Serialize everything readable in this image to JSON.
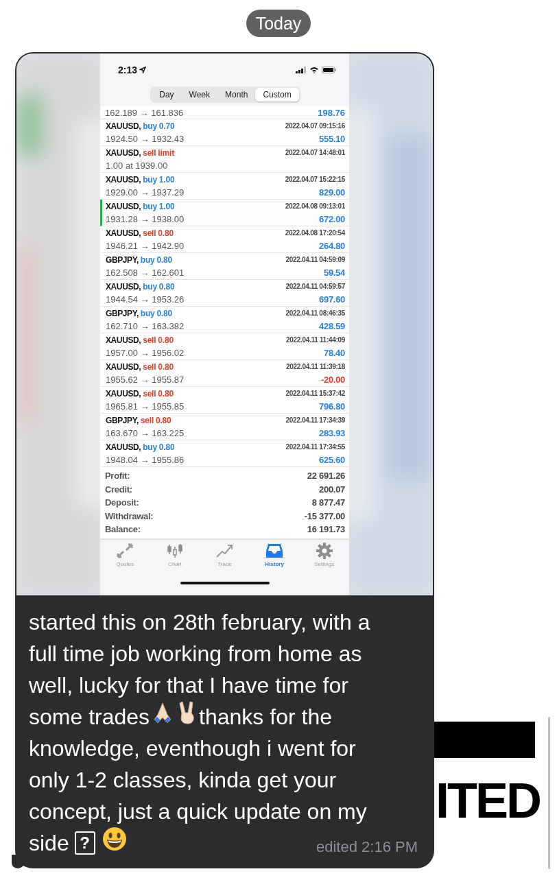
{
  "date_divider": "Today",
  "phone": {
    "status_time": "2:13",
    "periods": [
      {
        "label": "Day",
        "selected": false
      },
      {
        "label": "Week",
        "selected": false
      },
      {
        "label": "Month",
        "selected": false
      },
      {
        "label": "Custom",
        "selected": true
      }
    ],
    "partial_row": {
      "prices": "162.189 → 161.836",
      "profit": "198.76"
    },
    "trades": [
      {
        "symbol": "XAUUSD,",
        "side": "buy",
        "amount": "0.70",
        "time": "2022.04.07 09:15:16",
        "prices": "1924.50 → 1932.43",
        "profit": "555.10",
        "negative": false,
        "highlighted": false
      },
      {
        "symbol": "XAUUSD,",
        "side": "sell",
        "amount": "limit",
        "time": "2022.04.07 14:48:01",
        "prices": "1.00 at 1939.00",
        "highlighted": false
      },
      {
        "symbol": "XAUUSD,",
        "side": "buy",
        "amount": "1.00",
        "time": "2022.04.07 15:22:15",
        "prices": "1929.00 → 1937.29",
        "profit": "829.00",
        "negative": false,
        "highlighted": false
      },
      {
        "symbol": "XAUUSD,",
        "side": "buy",
        "amount": "1.00",
        "time": "2022.04.08 09:13:01",
        "prices": "1931.28 → 1938.00",
        "profit": "672.00",
        "negative": false,
        "highlighted": true
      },
      {
        "symbol": "XAUUSD,",
        "side": "sell",
        "amount": "0.80",
        "time": "2022.04.08 17:20:54",
        "prices": "1946.21 → 1942.90",
        "profit": "264.80",
        "negative": false,
        "highlighted": false
      },
      {
        "symbol": "GBPJPY,",
        "side": "buy",
        "amount": "0.80",
        "time": "2022.04.11 04:59:09",
        "prices": "162.508 → 162.601",
        "profit": "59.54",
        "negative": false,
        "highlighted": false
      },
      {
        "symbol": "XAUUSD,",
        "side": "buy",
        "amount": "0.80",
        "time": "2022.04.11 04:59:57",
        "prices": "1944.54 → 1953.26",
        "profit": "697.60",
        "negative": false,
        "highlighted": false
      },
      {
        "symbol": "GBPJPY,",
        "side": "buy",
        "amount": "0.80",
        "time": "2022.04.11 08:46:35",
        "prices": "162.710 → 163.382",
        "profit": "428.59",
        "negative": false,
        "highlighted": false
      },
      {
        "symbol": "XAUUSD,",
        "side": "sell",
        "amount": "0.80",
        "time": "2022.04.11 11:44:09",
        "prices": "1957.00 → 1956.02",
        "profit": "78.40",
        "negative": false,
        "highlighted": false
      },
      {
        "symbol": "XAUUSD,",
        "side": "sell",
        "amount": "0.80",
        "time": "2022.04.11 11:39:18",
        "prices": "1955.62 → 1955.87",
        "profit": "-20.00",
        "negative": true,
        "highlighted": false
      },
      {
        "symbol": "XAUUSD,",
        "side": "sell",
        "amount": "0.80",
        "time": "2022.04.11 15:37:42",
        "prices": "1965.81 → 1955.85",
        "profit": "796.80",
        "negative": false,
        "highlighted": false
      },
      {
        "symbol": "GBPJPY,",
        "side": "sell",
        "amount": "0.80",
        "time": "2022.04.11 17:34:39",
        "prices": "163.670 → 163.225",
        "profit": "283.93",
        "negative": false,
        "highlighted": false
      },
      {
        "symbol": "XAUUSD,",
        "side": "buy",
        "amount": "0.80",
        "time": "2022.04.11 17:34:55",
        "prices": "1948.04 → 1955.86",
        "profit": "625.60",
        "negative": false,
        "highlighted": false
      }
    ],
    "summary": [
      {
        "label": "Profit:",
        "value": "22 691.26"
      },
      {
        "label": "Credit:",
        "value": "200.07"
      },
      {
        "label": "Deposit:",
        "value": "8 877.47"
      },
      {
        "label": "Withdrawal:",
        "value": "-15 377.00"
      },
      {
        "label": "Balance:",
        "value": "16 191.73"
      }
    ],
    "tabs": [
      {
        "label": "Quotes",
        "kind": "quotes",
        "selected": false
      },
      {
        "label": "Chart",
        "kind": "chart",
        "selected": false
      },
      {
        "label": "Trade",
        "kind": "trade",
        "selected": false
      },
      {
        "label": "History",
        "kind": "history",
        "selected": true
      },
      {
        "label": "Settings",
        "kind": "settings",
        "selected": false
      }
    ]
  },
  "message": {
    "lines": [
      {
        "kind": "plain",
        "text": "started this on 28th february, with a"
      },
      {
        "kind": "plain",
        "text": "full time job working from home as"
      },
      {
        "kind": "plain",
        "text": "well, lucky for that I have time for"
      },
      {
        "kind": "emoji",
        "text": "some trades",
        "text_after": "thanks for the"
      },
      {
        "kind": "plain",
        "text": "knowledge, eventhough i went for"
      },
      {
        "kind": "plain",
        "text": "only 1-2 classes, kinda get your"
      },
      {
        "kind": "plain",
        "text": "concept, just a quick update on my"
      },
      {
        "kind": "end",
        "text": "side",
        "glyph": "?"
      }
    ],
    "edited": "edited 2:16 PM"
  },
  "side_text": "ITED"
}
